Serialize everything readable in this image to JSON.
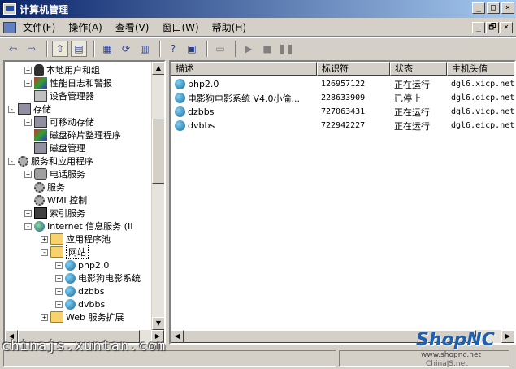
{
  "window": {
    "title": "计算机管理"
  },
  "caption_buttons": [
    "_",
    "□",
    "×"
  ],
  "mdi_buttons": [
    "_",
    "🗗",
    "×"
  ],
  "menu": [
    "文件(F)",
    "操作(A)",
    "查看(V)",
    "窗口(W)",
    "帮助(H)"
  ],
  "toolbar_icons": [
    "back-arrow",
    "forward-arrow",
    "up-folder",
    "show-tree",
    "properties",
    "refresh",
    "export-list",
    "help",
    "details-pane",
    "computer",
    "play",
    "stop",
    "pause"
  ],
  "tree": [
    {
      "label": "本地用户和组",
      "icon": "user",
      "level": 2,
      "expander": "+"
    },
    {
      "label": "性能日志和警报",
      "icon": "mixed",
      "level": 2,
      "expander": "+"
    },
    {
      "label": "设备管理器",
      "icon": "computer",
      "level": 2,
      "expander": ""
    },
    {
      "label": "存储",
      "icon": "disk",
      "level": 1,
      "expander": "-"
    },
    {
      "label": "可移动存储",
      "icon": "disk",
      "level": 2,
      "expander": "+"
    },
    {
      "label": "磁盘碎片整理程序",
      "icon": "mixed",
      "level": 2,
      "expander": ""
    },
    {
      "label": "磁盘管理",
      "icon": "disk",
      "level": 2,
      "expander": ""
    },
    {
      "label": "服务和应用程序",
      "icon": "gear",
      "level": 1,
      "expander": "-"
    },
    {
      "label": "电话服务",
      "icon": "phone",
      "level": 2,
      "expander": "+"
    },
    {
      "label": "服务",
      "icon": "gear",
      "level": 2,
      "expander": ""
    },
    {
      "label": "WMI 控制",
      "icon": "gear",
      "level": 2,
      "expander": ""
    },
    {
      "label": "索引服务",
      "icon": "search",
      "level": 2,
      "expander": "+"
    },
    {
      "label": "Internet 信息服务 (II",
      "icon": "iis",
      "level": 2,
      "expander": "-"
    },
    {
      "label": "应用程序池",
      "icon": "folder",
      "level": 3,
      "expander": "+"
    },
    {
      "label": "网站",
      "icon": "folder",
      "level": 3,
      "expander": "-"
    },
    {
      "label": "php2.0",
      "icon": "globe",
      "level": 4,
      "expander": "+"
    },
    {
      "label": "电影狗电影系统",
      "icon": "globe",
      "level": 4,
      "expander": "+"
    },
    {
      "label": "dzbbs",
      "icon": "globe",
      "level": 4,
      "expander": "+"
    },
    {
      "label": "dvbbs",
      "icon": "globe",
      "level": 4,
      "expander": "+"
    },
    {
      "label": "Web 服务扩展",
      "icon": "folder",
      "level": 3,
      "expander": "+"
    }
  ],
  "list": {
    "columns": [
      "描述",
      "标识符",
      "状态",
      "主机头值"
    ],
    "rows": [
      {
        "desc": "php2.0",
        "id": "126957122",
        "status": "正在运行",
        "host": "dgl6.xicp.net"
      },
      {
        "desc": "电影狗电影系统 V4.0小偷...",
        "id": "228633909",
        "status": "已停止",
        "host": "dgl6.oicp.net"
      },
      {
        "desc": "dzbbs",
        "id": "727063431",
        "status": "正在运行",
        "host": "dgl6.vicp.net"
      },
      {
        "desc": "dvbbs",
        "id": "722942227",
        "status": "正在运行",
        "host": "dgl6.eicp.net"
      }
    ]
  },
  "watermarks": {
    "left": "chinajs.xuntan.com",
    "logo": "ShopNC",
    "url": "www.shopnc.net",
    "url2": "ChinaJS.net"
  },
  "colors": {
    "titlebar": "#0a246a",
    "face": "#d4d0c8",
    "status_icon": "#1a6aa0"
  }
}
